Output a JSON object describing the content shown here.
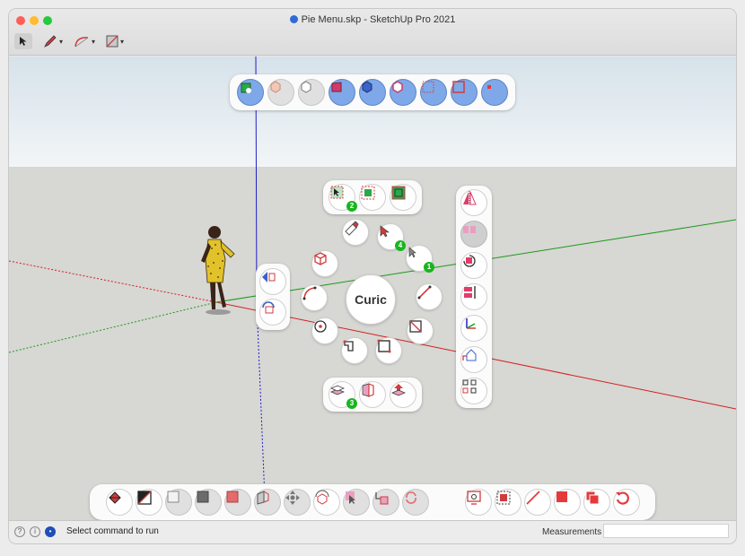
{
  "window": {
    "title": "Pie Menu.skp - SketchUp Pro 2021"
  },
  "toolbar": {
    "tools": [
      {
        "name": "select-tool",
        "icon": "arrow-cursor-icon"
      },
      {
        "name": "line-tool",
        "icon": "pencil-icon"
      },
      {
        "name": "arc-tool",
        "icon": "arc-icon"
      },
      {
        "name": "eraser-tool",
        "icon": "eraser-icon"
      }
    ]
  },
  "pie_menu": {
    "center_label": "Curic"
  },
  "badges": {
    "top_left": "2",
    "wheel_select": "4",
    "wheel_tape": "1",
    "bottom_left": "3"
  },
  "statusbar": {
    "message": "Select command to run",
    "measurements_label": "Measurements",
    "measurements_value": ""
  },
  "colors": {
    "accent_blue": "#7fa8e8",
    "icon_red": "#e43a3a",
    "badge_green": "#19b51e",
    "axis_red": "#d22020",
    "axis_green": "#1b9a1b",
    "axis_blue": "#2020c8"
  }
}
